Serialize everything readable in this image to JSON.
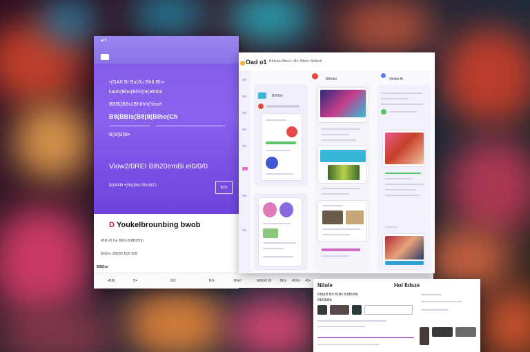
{
  "left_panel": {
    "top_label": "ai T",
    "nav_items": [
      "",
      "",
      "",
      ""
    ],
    "lines": [
      "•(GA0 Bl Bu(0u Bh8 Bls•",
      "kaoh(Bbo(Bhh(t8(Bhtlol",
      "BBB(|BBu(Bhtlhh(hlooh",
      "B8(BBls(B8(8(Biho(Ch",
      "B(B(B(bl•"
    ],
    "banner": "Viow2/0REI Bih20emBi ei0/0/0",
    "sub": "B(k84l8  •(Bo(8ho2Blohl20",
    "badge": "8(0h",
    "headline": "YoukeIbrounbing bwob",
    "headline_mark": "D",
    "desc_lines": [
      "•BB •B ha B8ho B8B(Bhh",
      "BB(ho 8B(B8 B(B B(B"
    ],
    "section": "BB(ho"
  },
  "nav_strip": [
    "•BB(",
    "B•",
    "Bl0",
    "BG",
    "BG0",
    "GBG0 Bl",
    "BIG",
    "•BIG",
    "•B•"
  ],
  "app": {
    "title": "Oad o1",
    "subtitle": "Bblsbo  Blboo  •Bh Blbho Bblboh",
    "col1_card_label": "Bhh8ol",
    "col2_caption": "BBh8ol",
    "col3_caption": "•Bh8ol Bi"
  },
  "br_panel": {
    "title_left": "NiloIe",
    "title_right": "Hol IbIsze",
    "sub1": "Bbb(B Bh B(B0 B8BhBb",
    "sub2": "BbGbBb"
  },
  "colors": {
    "purple": "#7f5ae6",
    "accent_red": "#c01a2c",
    "cyan": "#36b6d8",
    "green": "#59c66b",
    "pink": "#e4479a"
  }
}
